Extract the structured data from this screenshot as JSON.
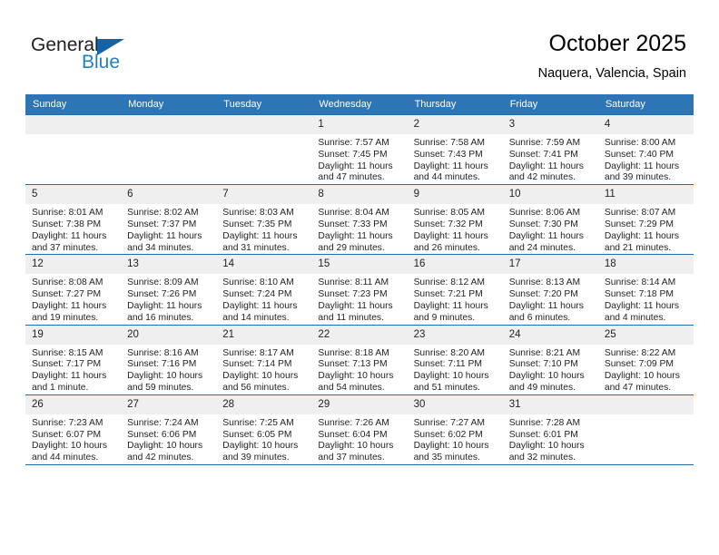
{
  "brand": {
    "word_one": "General",
    "word_two": "Blue",
    "accent_color": "#1163ab",
    "blue_text_color": "#1f7fcf"
  },
  "header": {
    "title": "October 2025",
    "location": "Naquera, Valencia, Spain"
  },
  "calendar": {
    "header_background": "#2e75b6",
    "header_text_color": "#ffffff",
    "daynum_background": "#efefef",
    "row_border_color": "#1f6cb0",
    "weekdays": [
      "Sunday",
      "Monday",
      "Tuesday",
      "Wednesday",
      "Thursday",
      "Friday",
      "Saturday"
    ],
    "weeks": [
      [
        {
          "day": "",
          "sunrise": "",
          "sunset": "",
          "daylight_line1": "",
          "daylight_line2": ""
        },
        {
          "day": "",
          "sunrise": "",
          "sunset": "",
          "daylight_line1": "",
          "daylight_line2": ""
        },
        {
          "day": "",
          "sunrise": "",
          "sunset": "",
          "daylight_line1": "",
          "daylight_line2": ""
        },
        {
          "day": "1",
          "sunrise": "Sunrise: 7:57 AM",
          "sunset": "Sunset: 7:45 PM",
          "daylight_line1": "Daylight: 11 hours",
          "daylight_line2": "and 47 minutes."
        },
        {
          "day": "2",
          "sunrise": "Sunrise: 7:58 AM",
          "sunset": "Sunset: 7:43 PM",
          "daylight_line1": "Daylight: 11 hours",
          "daylight_line2": "and 44 minutes."
        },
        {
          "day": "3",
          "sunrise": "Sunrise: 7:59 AM",
          "sunset": "Sunset: 7:41 PM",
          "daylight_line1": "Daylight: 11 hours",
          "daylight_line2": "and 42 minutes."
        },
        {
          "day": "4",
          "sunrise": "Sunrise: 8:00 AM",
          "sunset": "Sunset: 7:40 PM",
          "daylight_line1": "Daylight: 11 hours",
          "daylight_line2": "and 39 minutes."
        }
      ],
      [
        {
          "day": "5",
          "sunrise": "Sunrise: 8:01 AM",
          "sunset": "Sunset: 7:38 PM",
          "daylight_line1": "Daylight: 11 hours",
          "daylight_line2": "and 37 minutes."
        },
        {
          "day": "6",
          "sunrise": "Sunrise: 8:02 AM",
          "sunset": "Sunset: 7:37 PM",
          "daylight_line1": "Daylight: 11 hours",
          "daylight_line2": "and 34 minutes."
        },
        {
          "day": "7",
          "sunrise": "Sunrise: 8:03 AM",
          "sunset": "Sunset: 7:35 PM",
          "daylight_line1": "Daylight: 11 hours",
          "daylight_line2": "and 31 minutes."
        },
        {
          "day": "8",
          "sunrise": "Sunrise: 8:04 AM",
          "sunset": "Sunset: 7:33 PM",
          "daylight_line1": "Daylight: 11 hours",
          "daylight_line2": "and 29 minutes."
        },
        {
          "day": "9",
          "sunrise": "Sunrise: 8:05 AM",
          "sunset": "Sunset: 7:32 PM",
          "daylight_line1": "Daylight: 11 hours",
          "daylight_line2": "and 26 minutes."
        },
        {
          "day": "10",
          "sunrise": "Sunrise: 8:06 AM",
          "sunset": "Sunset: 7:30 PM",
          "daylight_line1": "Daylight: 11 hours",
          "daylight_line2": "and 24 minutes."
        },
        {
          "day": "11",
          "sunrise": "Sunrise: 8:07 AM",
          "sunset": "Sunset: 7:29 PM",
          "daylight_line1": "Daylight: 11 hours",
          "daylight_line2": "and 21 minutes."
        }
      ],
      [
        {
          "day": "12",
          "sunrise": "Sunrise: 8:08 AM",
          "sunset": "Sunset: 7:27 PM",
          "daylight_line1": "Daylight: 11 hours",
          "daylight_line2": "and 19 minutes."
        },
        {
          "day": "13",
          "sunrise": "Sunrise: 8:09 AM",
          "sunset": "Sunset: 7:26 PM",
          "daylight_line1": "Daylight: 11 hours",
          "daylight_line2": "and 16 minutes."
        },
        {
          "day": "14",
          "sunrise": "Sunrise: 8:10 AM",
          "sunset": "Sunset: 7:24 PM",
          "daylight_line1": "Daylight: 11 hours",
          "daylight_line2": "and 14 minutes."
        },
        {
          "day": "15",
          "sunrise": "Sunrise: 8:11 AM",
          "sunset": "Sunset: 7:23 PM",
          "daylight_line1": "Daylight: 11 hours",
          "daylight_line2": "and 11 minutes."
        },
        {
          "day": "16",
          "sunrise": "Sunrise: 8:12 AM",
          "sunset": "Sunset: 7:21 PM",
          "daylight_line1": "Daylight: 11 hours",
          "daylight_line2": "and 9 minutes."
        },
        {
          "day": "17",
          "sunrise": "Sunrise: 8:13 AM",
          "sunset": "Sunset: 7:20 PM",
          "daylight_line1": "Daylight: 11 hours",
          "daylight_line2": "and 6 minutes."
        },
        {
          "day": "18",
          "sunrise": "Sunrise: 8:14 AM",
          "sunset": "Sunset: 7:18 PM",
          "daylight_line1": "Daylight: 11 hours",
          "daylight_line2": "and 4 minutes."
        }
      ],
      [
        {
          "day": "19",
          "sunrise": "Sunrise: 8:15 AM",
          "sunset": "Sunset: 7:17 PM",
          "daylight_line1": "Daylight: 11 hours",
          "daylight_line2": "and 1 minute."
        },
        {
          "day": "20",
          "sunrise": "Sunrise: 8:16 AM",
          "sunset": "Sunset: 7:16 PM",
          "daylight_line1": "Daylight: 10 hours",
          "daylight_line2": "and 59 minutes."
        },
        {
          "day": "21",
          "sunrise": "Sunrise: 8:17 AM",
          "sunset": "Sunset: 7:14 PM",
          "daylight_line1": "Daylight: 10 hours",
          "daylight_line2": "and 56 minutes."
        },
        {
          "day": "22",
          "sunrise": "Sunrise: 8:18 AM",
          "sunset": "Sunset: 7:13 PM",
          "daylight_line1": "Daylight: 10 hours",
          "daylight_line2": "and 54 minutes."
        },
        {
          "day": "23",
          "sunrise": "Sunrise: 8:20 AM",
          "sunset": "Sunset: 7:11 PM",
          "daylight_line1": "Daylight: 10 hours",
          "daylight_line2": "and 51 minutes."
        },
        {
          "day": "24",
          "sunrise": "Sunrise: 8:21 AM",
          "sunset": "Sunset: 7:10 PM",
          "daylight_line1": "Daylight: 10 hours",
          "daylight_line2": "and 49 minutes."
        },
        {
          "day": "25",
          "sunrise": "Sunrise: 8:22 AM",
          "sunset": "Sunset: 7:09 PM",
          "daylight_line1": "Daylight: 10 hours",
          "daylight_line2": "and 47 minutes."
        }
      ],
      [
        {
          "day": "26",
          "sunrise": "Sunrise: 7:23 AM",
          "sunset": "Sunset: 6:07 PM",
          "daylight_line1": "Daylight: 10 hours",
          "daylight_line2": "and 44 minutes."
        },
        {
          "day": "27",
          "sunrise": "Sunrise: 7:24 AM",
          "sunset": "Sunset: 6:06 PM",
          "daylight_line1": "Daylight: 10 hours",
          "daylight_line2": "and 42 minutes."
        },
        {
          "day": "28",
          "sunrise": "Sunrise: 7:25 AM",
          "sunset": "Sunset: 6:05 PM",
          "daylight_line1": "Daylight: 10 hours",
          "daylight_line2": "and 39 minutes."
        },
        {
          "day": "29",
          "sunrise": "Sunrise: 7:26 AM",
          "sunset": "Sunset: 6:04 PM",
          "daylight_line1": "Daylight: 10 hours",
          "daylight_line2": "and 37 minutes."
        },
        {
          "day": "30",
          "sunrise": "Sunrise: 7:27 AM",
          "sunset": "Sunset: 6:02 PM",
          "daylight_line1": "Daylight: 10 hours",
          "daylight_line2": "and 35 minutes."
        },
        {
          "day": "31",
          "sunrise": "Sunrise: 7:28 AM",
          "sunset": "Sunset: 6:01 PM",
          "daylight_line1": "Daylight: 10 hours",
          "daylight_line2": "and 32 minutes."
        },
        {
          "day": "",
          "sunrise": "",
          "sunset": "",
          "daylight_line1": "",
          "daylight_line2": ""
        }
      ]
    ]
  }
}
